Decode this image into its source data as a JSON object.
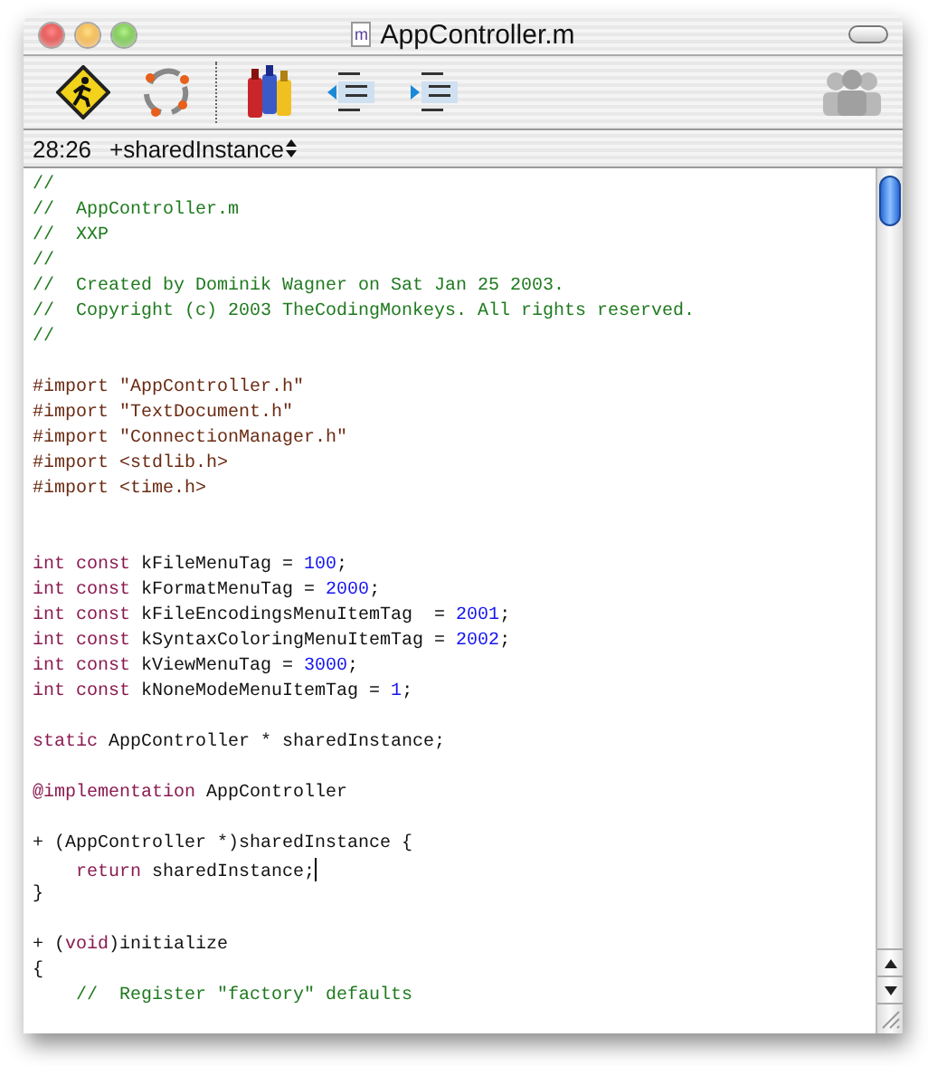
{
  "window": {
    "title": "AppController.m",
    "document_badge": "m"
  },
  "status_bar": {
    "position": "28:26",
    "symbol": "+sharedInstance"
  },
  "editor": {
    "lines": [
      {
        "kind": "code",
        "tokens": [
          {
            "kind": "comment",
            "text": "//"
          }
        ]
      },
      {
        "kind": "code",
        "tokens": [
          {
            "kind": "comment",
            "text": "//  AppController.m"
          }
        ]
      },
      {
        "kind": "code",
        "tokens": [
          {
            "kind": "comment",
            "text": "//  XXP"
          }
        ]
      },
      {
        "kind": "code",
        "tokens": [
          {
            "kind": "comment",
            "text": "//"
          }
        ]
      },
      {
        "kind": "code",
        "tokens": [
          {
            "kind": "comment",
            "text": "//  Created by Dominik Wagner on Sat Jan 25 2003."
          }
        ]
      },
      {
        "kind": "code",
        "tokens": [
          {
            "kind": "comment",
            "text": "//  Copyright (c) 2003 TheCodingMonkeys. All rights reserved."
          }
        ]
      },
      {
        "kind": "code",
        "tokens": [
          {
            "kind": "comment",
            "text": "//"
          }
        ]
      },
      {
        "kind": "blank"
      },
      {
        "kind": "code",
        "tokens": [
          {
            "kind": "preprocessor",
            "text": "#import \"AppController.h\""
          }
        ]
      },
      {
        "kind": "code",
        "tokens": [
          {
            "kind": "preprocessor",
            "text": "#import \"TextDocument.h\""
          }
        ]
      },
      {
        "kind": "code",
        "tokens": [
          {
            "kind": "preprocessor",
            "text": "#import \"ConnectionManager.h\""
          }
        ]
      },
      {
        "kind": "code",
        "tokens": [
          {
            "kind": "preprocessor",
            "text": "#import <stdlib.h>"
          }
        ]
      },
      {
        "kind": "code",
        "tokens": [
          {
            "kind": "preprocessor",
            "text": "#import <time.h>"
          }
        ]
      },
      {
        "kind": "blank"
      },
      {
        "kind": "blank"
      },
      {
        "kind": "code",
        "tokens": [
          {
            "kind": "keyword",
            "text": "int const"
          },
          {
            "kind": "plain",
            "text": " kFileMenuTag = "
          },
          {
            "kind": "number",
            "text": "100"
          },
          {
            "kind": "plain",
            "text": ";"
          }
        ]
      },
      {
        "kind": "code",
        "tokens": [
          {
            "kind": "keyword",
            "text": "int const"
          },
          {
            "kind": "plain",
            "text": " kFormatMenuTag = "
          },
          {
            "kind": "number",
            "text": "2000"
          },
          {
            "kind": "plain",
            "text": ";"
          }
        ]
      },
      {
        "kind": "code",
        "tokens": [
          {
            "kind": "keyword",
            "text": "int const"
          },
          {
            "kind": "plain",
            "text": " kFileEncodingsMenuItemTag  = "
          },
          {
            "kind": "number",
            "text": "2001"
          },
          {
            "kind": "plain",
            "text": ";"
          }
        ]
      },
      {
        "kind": "code",
        "tokens": [
          {
            "kind": "keyword",
            "text": "int const"
          },
          {
            "kind": "plain",
            "text": " kSyntaxColoringMenuItemTag = "
          },
          {
            "kind": "number",
            "text": "2002"
          },
          {
            "kind": "plain",
            "text": ";"
          }
        ]
      },
      {
        "kind": "code",
        "tokens": [
          {
            "kind": "keyword",
            "text": "int const"
          },
          {
            "kind": "plain",
            "text": " kViewMenuTag = "
          },
          {
            "kind": "number",
            "text": "3000"
          },
          {
            "kind": "plain",
            "text": ";"
          }
        ]
      },
      {
        "kind": "code",
        "tokens": [
          {
            "kind": "keyword",
            "text": "int const"
          },
          {
            "kind": "plain",
            "text": " kNoneModeMenuItemTag = "
          },
          {
            "kind": "number",
            "text": "1"
          },
          {
            "kind": "plain",
            "text": ";"
          }
        ]
      },
      {
        "kind": "blank"
      },
      {
        "kind": "code",
        "tokens": [
          {
            "kind": "keyword",
            "text": "static"
          },
          {
            "kind": "plain",
            "text": " AppController * sharedInstance;"
          }
        ]
      },
      {
        "kind": "blank"
      },
      {
        "kind": "code",
        "tokens": [
          {
            "kind": "keyword",
            "text": "@implementation"
          },
          {
            "kind": "plain",
            "text": " AppController"
          }
        ]
      },
      {
        "kind": "blank"
      },
      {
        "kind": "code",
        "tokens": [
          {
            "kind": "plain",
            "text": "+ (AppController *)sharedInstance {"
          }
        ]
      },
      {
        "kind": "code",
        "cursor": true,
        "indented": true,
        "tokens": [
          {
            "kind": "keyword",
            "text": "return"
          },
          {
            "kind": "plain",
            "text": " sharedInstance;"
          }
        ]
      },
      {
        "kind": "code",
        "tokens": [
          {
            "kind": "plain",
            "text": "}"
          }
        ]
      },
      {
        "kind": "blank"
      },
      {
        "kind": "code",
        "tokens": [
          {
            "kind": "plain",
            "text": "+ ("
          },
          {
            "kind": "keyword",
            "text": "void"
          },
          {
            "kind": "plain",
            "text": ")initialize"
          }
        ]
      },
      {
        "kind": "code",
        "tokens": [
          {
            "kind": "plain",
            "text": "{"
          }
        ]
      },
      {
        "kind": "code",
        "indented": true,
        "tokens": [
          {
            "kind": "comment",
            "text": "//  Register \"factory\" defaults"
          }
        ]
      }
    ]
  }
}
